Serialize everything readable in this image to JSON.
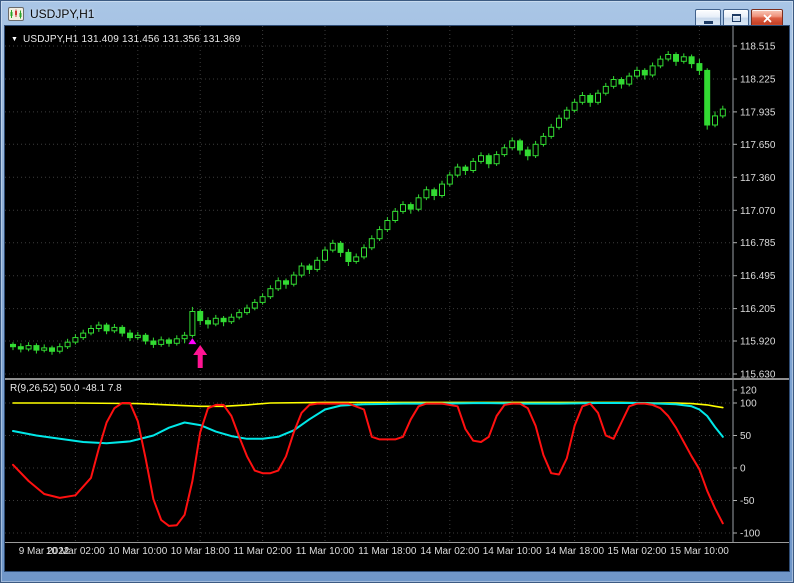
{
  "window": {
    "title": "USDJPY,H1"
  },
  "main_chart": {
    "dropdown_glyph": "▼",
    "ohlc_label": "USDJPY,H1 131.409 131.456 131.356 131.369"
  },
  "indicator_panel": {
    "label": "R(9,26,52) 50.0 -48.1 7.8"
  },
  "chart_data": [
    {
      "type": "candlestick",
      "symbol": "USDJPY",
      "timeframe": "H1",
      "ohlc_display": "131.409 131.456 131.356 131.369",
      "background": "#000000",
      "grid_color": "#3C3C3C",
      "axis_text_color": "#DCDCDC",
      "candle_color": "#33DB33",
      "bull_fill": "#000000",
      "time_labels": [
        "9 Mar 2022",
        "10 Mar 02:00",
        "10 Mar 10:00",
        "10 Mar 18:00",
        "11 Mar 02:00",
        "11 Mar 10:00",
        "11 Mar 18:00",
        "14 Mar 02:00",
        "14 Mar 10:00",
        "14 Mar 18:00",
        "15 Mar 02:00",
        "15 Mar 10:00"
      ],
      "price_ticks": [
        118.515,
        118.225,
        117.935,
        117.65,
        117.36,
        117.07,
        116.785,
        116.495,
        116.205,
        115.92,
        115.63
      ],
      "markers": [
        {
          "type": "small-up-triangle",
          "index": 23,
          "price": 115.945,
          "color": "#FF00FF"
        },
        {
          "type": "up-arrow",
          "index": 24,
          "price": 115.885,
          "color": "#FF1493"
        }
      ],
      "candles": [
        [
          115.89,
          115.91,
          115.84,
          115.87
        ],
        [
          115.87,
          115.9,
          115.82,
          115.85
        ],
        [
          115.85,
          115.91,
          115.83,
          115.88
        ],
        [
          115.88,
          115.9,
          115.81,
          115.84
        ],
        [
          115.84,
          115.89,
          115.82,
          115.86
        ],
        [
          115.86,
          115.88,
          115.8,
          115.83
        ],
        [
          115.83,
          115.9,
          115.81,
          115.87
        ],
        [
          115.87,
          115.94,
          115.85,
          115.91
        ],
        [
          115.91,
          115.98,
          115.89,
          115.95
        ],
        [
          115.95,
          116.02,
          115.93,
          115.99
        ],
        [
          115.99,
          116.06,
          115.97,
          116.03
        ],
        [
          116.03,
          116.09,
          116.0,
          116.06
        ],
        [
          116.06,
          116.08,
          115.98,
          116.01
        ],
        [
          116.01,
          116.07,
          115.99,
          116.04
        ],
        [
          116.04,
          116.06,
          115.96,
          115.99
        ],
        [
          115.99,
          116.02,
          115.92,
          115.95
        ],
        [
          115.95,
          116.0,
          115.93,
          115.97
        ],
        [
          115.97,
          115.99,
          115.89,
          115.92
        ],
        [
          115.92,
          115.95,
          115.86,
          115.89
        ],
        [
          115.89,
          115.96,
          115.87,
          115.93
        ],
        [
          115.93,
          115.95,
          115.87,
          115.9
        ],
        [
          115.9,
          115.97,
          115.88,
          115.94
        ],
        [
          115.94,
          116.0,
          115.9,
          115.97
        ],
        [
          115.97,
          116.22,
          115.95,
          116.18
        ],
        [
          116.18,
          116.2,
          116.06,
          116.1
        ],
        [
          116.1,
          116.13,
          116.03,
          116.07
        ],
        [
          116.07,
          116.15,
          116.05,
          116.12
        ],
        [
          116.12,
          116.14,
          116.05,
          116.09
        ],
        [
          116.09,
          116.16,
          116.07,
          116.13
        ],
        [
          116.13,
          116.2,
          116.11,
          116.17
        ],
        [
          116.17,
          116.24,
          116.15,
          116.21
        ],
        [
          116.21,
          116.29,
          116.19,
          116.26
        ],
        [
          116.26,
          116.34,
          116.24,
          116.31
        ],
        [
          116.31,
          116.41,
          116.29,
          116.38
        ],
        [
          116.38,
          116.48,
          116.36,
          116.45
        ],
        [
          116.45,
          116.47,
          116.38,
          116.42
        ],
        [
          116.42,
          116.53,
          116.4,
          116.5
        ],
        [
          116.5,
          116.61,
          116.48,
          116.58
        ],
        [
          116.58,
          116.6,
          116.51,
          116.55
        ],
        [
          116.55,
          116.66,
          116.53,
          116.63
        ],
        [
          116.63,
          116.75,
          116.61,
          116.72
        ],
        [
          116.72,
          116.81,
          116.7,
          116.78
        ],
        [
          116.78,
          116.8,
          116.66,
          116.7
        ],
        [
          116.7,
          116.73,
          116.58,
          116.62
        ],
        [
          116.62,
          116.69,
          116.6,
          116.66
        ],
        [
          116.66,
          116.77,
          116.64,
          116.74
        ],
        [
          116.74,
          116.85,
          116.72,
          116.82
        ],
        [
          116.82,
          116.93,
          116.8,
          116.9
        ],
        [
          116.9,
          117.01,
          116.88,
          116.98
        ],
        [
          116.98,
          117.09,
          116.96,
          117.06
        ],
        [
          117.06,
          117.15,
          117.04,
          117.12
        ],
        [
          117.12,
          117.14,
          117.04,
          117.08
        ],
        [
          117.08,
          117.21,
          117.06,
          117.18
        ],
        [
          117.18,
          117.28,
          117.16,
          117.25
        ],
        [
          117.25,
          117.27,
          117.16,
          117.2
        ],
        [
          117.2,
          117.33,
          117.18,
          117.3
        ],
        [
          117.3,
          117.41,
          117.28,
          117.38
        ],
        [
          117.38,
          117.48,
          117.36,
          117.45
        ],
        [
          117.45,
          117.47,
          117.38,
          117.42
        ],
        [
          117.42,
          117.53,
          117.4,
          117.5
        ],
        [
          117.5,
          117.58,
          117.48,
          117.55
        ],
        [
          117.55,
          117.57,
          117.44,
          117.48
        ],
        [
          117.48,
          117.59,
          117.46,
          117.56
        ],
        [
          117.56,
          117.65,
          117.54,
          117.62
        ],
        [
          117.62,
          117.71,
          117.6,
          117.68
        ],
        [
          117.68,
          117.7,
          117.56,
          117.6
        ],
        [
          117.6,
          117.63,
          117.51,
          117.55
        ],
        [
          117.55,
          117.68,
          117.53,
          117.65
        ],
        [
          117.65,
          117.75,
          117.63,
          117.72
        ],
        [
          117.72,
          117.83,
          117.7,
          117.8
        ],
        [
          117.8,
          117.91,
          117.78,
          117.88
        ],
        [
          117.88,
          117.98,
          117.86,
          117.95
        ],
        [
          117.95,
          118.05,
          117.93,
          118.02
        ],
        [
          118.02,
          118.11,
          118.0,
          118.08
        ],
        [
          118.08,
          118.1,
          117.98,
          118.02
        ],
        [
          118.02,
          118.13,
          118.0,
          118.1
        ],
        [
          118.1,
          118.19,
          118.08,
          118.16
        ],
        [
          118.16,
          118.25,
          118.14,
          118.22
        ],
        [
          118.22,
          118.24,
          118.14,
          118.18
        ],
        [
          118.18,
          118.28,
          118.16,
          118.25
        ],
        [
          118.25,
          118.33,
          118.23,
          118.3
        ],
        [
          118.3,
          118.32,
          118.22,
          118.26
        ],
        [
          118.26,
          118.37,
          118.24,
          118.34
        ],
        [
          118.34,
          118.43,
          118.32,
          118.4
        ],
        [
          118.4,
          118.47,
          118.38,
          118.44
        ],
        [
          118.44,
          118.46,
          118.34,
          118.38
        ],
        [
          118.38,
          118.45,
          118.36,
          118.42
        ],
        [
          118.42,
          118.44,
          118.32,
          118.36
        ],
        [
          118.36,
          118.4,
          118.26,
          118.3
        ],
        [
          118.3,
          118.32,
          117.78,
          117.82
        ],
        [
          117.82,
          117.94,
          117.8,
          117.9
        ],
        [
          117.9,
          117.99,
          117.88,
          117.96
        ]
      ]
    },
    {
      "type": "line",
      "label": "R(9,26,52) 50.0 -48.1 7.8",
      "value_ticks": [
        120,
        100,
        50,
        0,
        -50,
        -100
      ],
      "ylim": [
        -117,
        132
      ],
      "series": [
        {
          "name": "yellow",
          "color": "#FFFF00",
          "width": 1.6,
          "points": [
            [
              0,
              100
            ],
            [
              8,
              100
            ],
            [
              16,
              99
            ],
            [
              20,
              97
            ],
            [
              24,
              95
            ],
            [
              27,
              95
            ],
            [
              30,
              97
            ],
            [
              33,
              100
            ],
            [
              40,
              101
            ],
            [
              50,
              101
            ],
            [
              60,
              101
            ],
            [
              70,
              101
            ],
            [
              78,
              101
            ],
            [
              82,
              100
            ],
            [
              85,
              100
            ],
            [
              87,
              99
            ],
            [
              89,
              97
            ],
            [
              90,
              95
            ],
            [
              91,
              93
            ]
          ]
        },
        {
          "name": "cyan",
          "color": "#00E8E8",
          "width": 2,
          "points": [
            [
              0,
              57
            ],
            [
              3,
              50
            ],
            [
              6,
              45
            ],
            [
              9,
              40
            ],
            [
              12,
              38
            ],
            [
              15,
              41
            ],
            [
              18,
              50
            ],
            [
              20,
              62
            ],
            [
              22,
              70
            ],
            [
              24,
              66
            ],
            [
              26,
              56
            ],
            [
              28,
              49
            ],
            [
              30,
              45
            ],
            [
              32,
              45
            ],
            [
              34,
              48
            ],
            [
              36,
              58
            ],
            [
              38,
              75
            ],
            [
              40,
              90
            ],
            [
              42,
              96
            ],
            [
              45,
              98
            ],
            [
              50,
              99
            ],
            [
              55,
              99
            ],
            [
              60,
              100
            ],
            [
              65,
              99
            ],
            [
              70,
              99
            ],
            [
              75,
              100
            ],
            [
              80,
              100
            ],
            [
              83,
              99
            ],
            [
              85,
              98
            ],
            [
              87,
              95
            ],
            [
              88,
              90
            ],
            [
              89,
              80
            ],
            [
              90,
              63
            ],
            [
              91,
              48
            ]
          ]
        },
        {
          "name": "red",
          "color": "#FF1010",
          "width": 2,
          "points": [
            [
              0,
              5
            ],
            [
              2,
              -20
            ],
            [
              4,
              -40
            ],
            [
              6,
              -46
            ],
            [
              8,
              -42
            ],
            [
              10,
              -15
            ],
            [
              11,
              30
            ],
            [
              12,
              70
            ],
            [
              13,
              92
            ],
            [
              14,
              100
            ],
            [
              15,
              100
            ],
            [
              16,
              72
            ],
            [
              17,
              15
            ],
            [
              18,
              -48
            ],
            [
              19,
              -80
            ],
            [
              20,
              -89
            ],
            [
              21,
              -88
            ],
            [
              22,
              -72
            ],
            [
              23,
              -20
            ],
            [
              24,
              55
            ],
            [
              25,
              92
            ],
            [
              26,
              97
            ],
            [
              27,
              97
            ],
            [
              28,
              80
            ],
            [
              29,
              48
            ],
            [
              30,
              18
            ],
            [
              31,
              -4
            ],
            [
              32,
              -8
            ],
            [
              33,
              -8
            ],
            [
              34,
              -4
            ],
            [
              35,
              18
            ],
            [
              36,
              55
            ],
            [
              37,
              85
            ],
            [
              38,
              97
            ],
            [
              39,
              99
            ],
            [
              41,
              99
            ],
            [
              43,
              99
            ],
            [
              45,
              90
            ],
            [
              46,
              48
            ],
            [
              47,
              44
            ],
            [
              49,
              44
            ],
            [
              50,
              48
            ],
            [
              51,
              75
            ],
            [
              52,
              95
            ],
            [
              53,
              99
            ],
            [
              55,
              99
            ],
            [
              57,
              95
            ],
            [
              58,
              60
            ],
            [
              59,
              42
            ],
            [
              60,
              40
            ],
            [
              61,
              48
            ],
            [
              62,
              80
            ],
            [
              63,
              97
            ],
            [
              64,
              99
            ],
            [
              65,
              99
            ],
            [
              66,
              92
            ],
            [
              67,
              65
            ],
            [
              68,
              20
            ],
            [
              69,
              -8
            ],
            [
              70,
              -10
            ],
            [
              71,
              15
            ],
            [
              72,
              65
            ],
            [
              73,
              95
            ],
            [
              74,
              99
            ],
            [
              75,
              85
            ],
            [
              76,
              50
            ],
            [
              77,
              45
            ],
            [
              78,
              70
            ],
            [
              79,
              95
            ],
            [
              80,
              99
            ],
            [
              81,
              99
            ],
            [
              82,
              97
            ],
            [
              83,
              92
            ],
            [
              84,
              80
            ],
            [
              85,
              62
            ],
            [
              86,
              40
            ],
            [
              87,
              18
            ],
            [
              88,
              -2
            ],
            [
              89,
              -35
            ],
            [
              90,
              -62
            ],
            [
              91,
              -85
            ]
          ]
        }
      ]
    }
  ]
}
